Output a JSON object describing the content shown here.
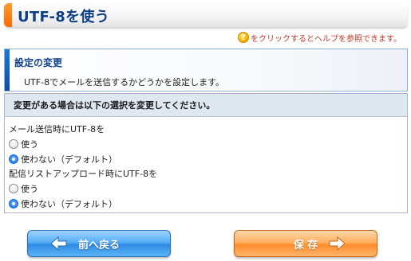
{
  "header": {
    "title": "UTF-8を使う"
  },
  "help": {
    "icon": "help-icon",
    "glyph": "?",
    "text": "をクリックするとヘルプを参照できます。"
  },
  "settings": {
    "title": "設定の変更",
    "description": "UTF-8でメールを送信するかどうかを設定します。"
  },
  "panel": {
    "instruction": "変更がある場合は以下の選択を変更してください。",
    "groups": [
      {
        "label": "メール送信時にUTF-8を",
        "options": [
          {
            "label": "使う",
            "selected": false
          },
          {
            "label": "使わない（デフォルト）",
            "selected": true
          }
        ]
      },
      {
        "label": "配信リストアップロード時にUTF-8を",
        "options": [
          {
            "label": "使う",
            "selected": false
          },
          {
            "label": "使わない（デフォルト）",
            "selected": true
          }
        ]
      }
    ]
  },
  "buttons": {
    "back_label": "前へ戻る",
    "save_label": "保 存"
  },
  "colors": {
    "title_text": "#0d3f86",
    "title_accent": "#ff6a00",
    "help_text": "#c0392b",
    "back_button": "#2e8be3",
    "save_button": "#ff8d2b"
  }
}
